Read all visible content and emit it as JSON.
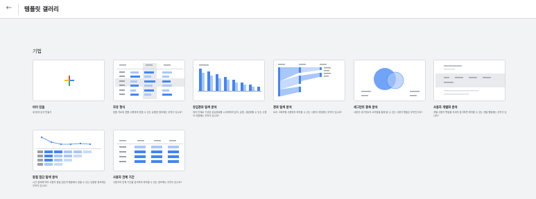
{
  "header": {
    "back_icon": "arrow-left-icon",
    "title": "템플릿 갤러리"
  },
  "section": {
    "title": "기법"
  },
  "templates": [
    {
      "title": "비어 있음",
      "description": "새 탐색 분석 만들기"
    },
    {
      "title": "자유 형식",
      "description": "맞춤 차트와 표를 사용하여 맞춤 수 있는 유용한 정보에는 무엇이 있나요?"
    },
    {
      "title": "유입경로 탐색 분석",
      "description": "여러 단계로 구성된 유입경로를 시각화하여 분석, 분류, 세분화할 수 있는 사용자 여정에는 무엇이 있나요?"
    },
    {
      "title": "경로 탐색 분석",
      "description": "트리 그래프를 사용하여 파악할 수 있는 사용자 여정에는 무엇이 있나요?"
    },
    {
      "title": "세그먼트 중복 분석",
      "description": "사용자 세그먼트의 교차점을 통해 알 수 있는 사용자 행동은 무엇인가요?"
    },
    {
      "title": "사용자 개별화 분석",
      "description": "개별 사용자 활동을 자세히 분석하면 파악할 수 있는 개별 행동에는 무엇이 있나요?"
    },
    {
      "title": "동질 집단 탐색 분석",
      "description": "시간 경과에 따라 사용자 동질 집단의 행동에서 얻을 수 있는 유용한 정보에는 무엇이 있나요?"
    },
    {
      "title": "사용자 전체 기간",
      "description": "사용자의 전체 기간을 분석하여 파악할 수 있는 정보에는 무엇이 있나요?"
    }
  ],
  "colors": {
    "blue": "#4285f4",
    "light_blue": "#a8c7fa",
    "plus_red": "#ea4335",
    "plus_yellow": "#fbbc04",
    "plus_green": "#34a853"
  }
}
